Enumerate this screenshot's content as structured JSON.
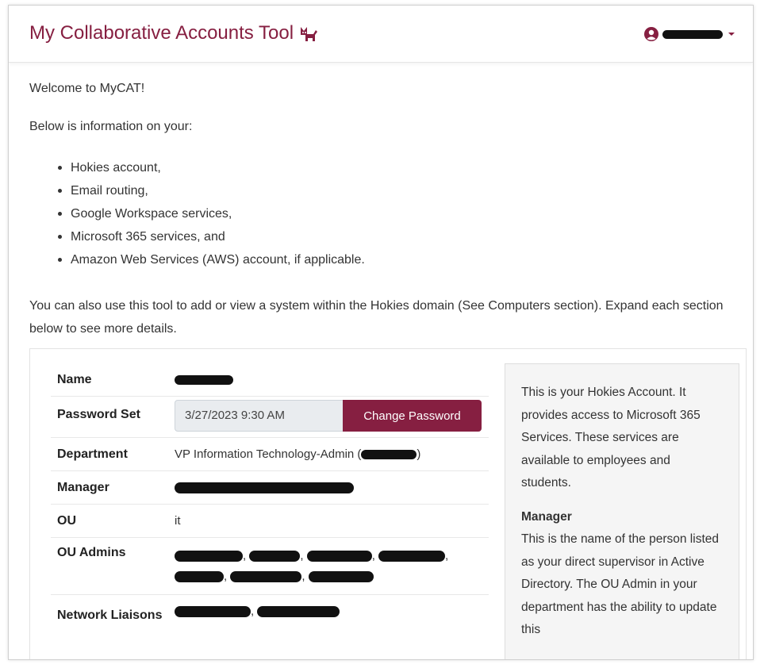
{
  "header": {
    "title": "My Collaborative Accounts Tool",
    "logo_icon": "cat-icon",
    "account_icon": "user-circle-icon",
    "account_caret_icon": "caret-down-icon"
  },
  "intro": {
    "welcome": "Welcome to MyCAT!",
    "lead": "Below is information on your:",
    "bullets": [
      "Hokies account,",
      "Email routing,",
      "Google Workspace services,",
      "Microsoft 365 services, and",
      "Amazon Web Services (AWS) account, if applicable."
    ],
    "paragraph": "You can also use this tool to add or view a system within the Hokies domain (See Computers section). Expand each section below to see more details."
  },
  "account": {
    "name_label": "Name",
    "password_label": "Password Set",
    "password_date": "3/27/2023 9:30 AM",
    "change_password_label": "Change Password",
    "department_label": "Department",
    "department_value": "VP Information Technology-Admin (",
    "department_close": ")",
    "manager_label": "Manager",
    "ou_label": "OU",
    "ou_value": "it",
    "ou_admins_label": "OU Admins",
    "network_liaisons_label": "Network Liaisons",
    "separator": ","
  },
  "help": {
    "intro": "This is your Hokies Account. It provides access to Microsoft 365 Services. These services are available to employees and students.",
    "manager_title": "Manager",
    "manager_text": "This is the name of the person listed as your direct supervisor in Active Directory.  The OU Admin in your department has the ability to update this"
  },
  "colors": {
    "brand": "#861f41",
    "panel_bg": "#f5f5f5",
    "field_bg": "#e9ecef"
  }
}
